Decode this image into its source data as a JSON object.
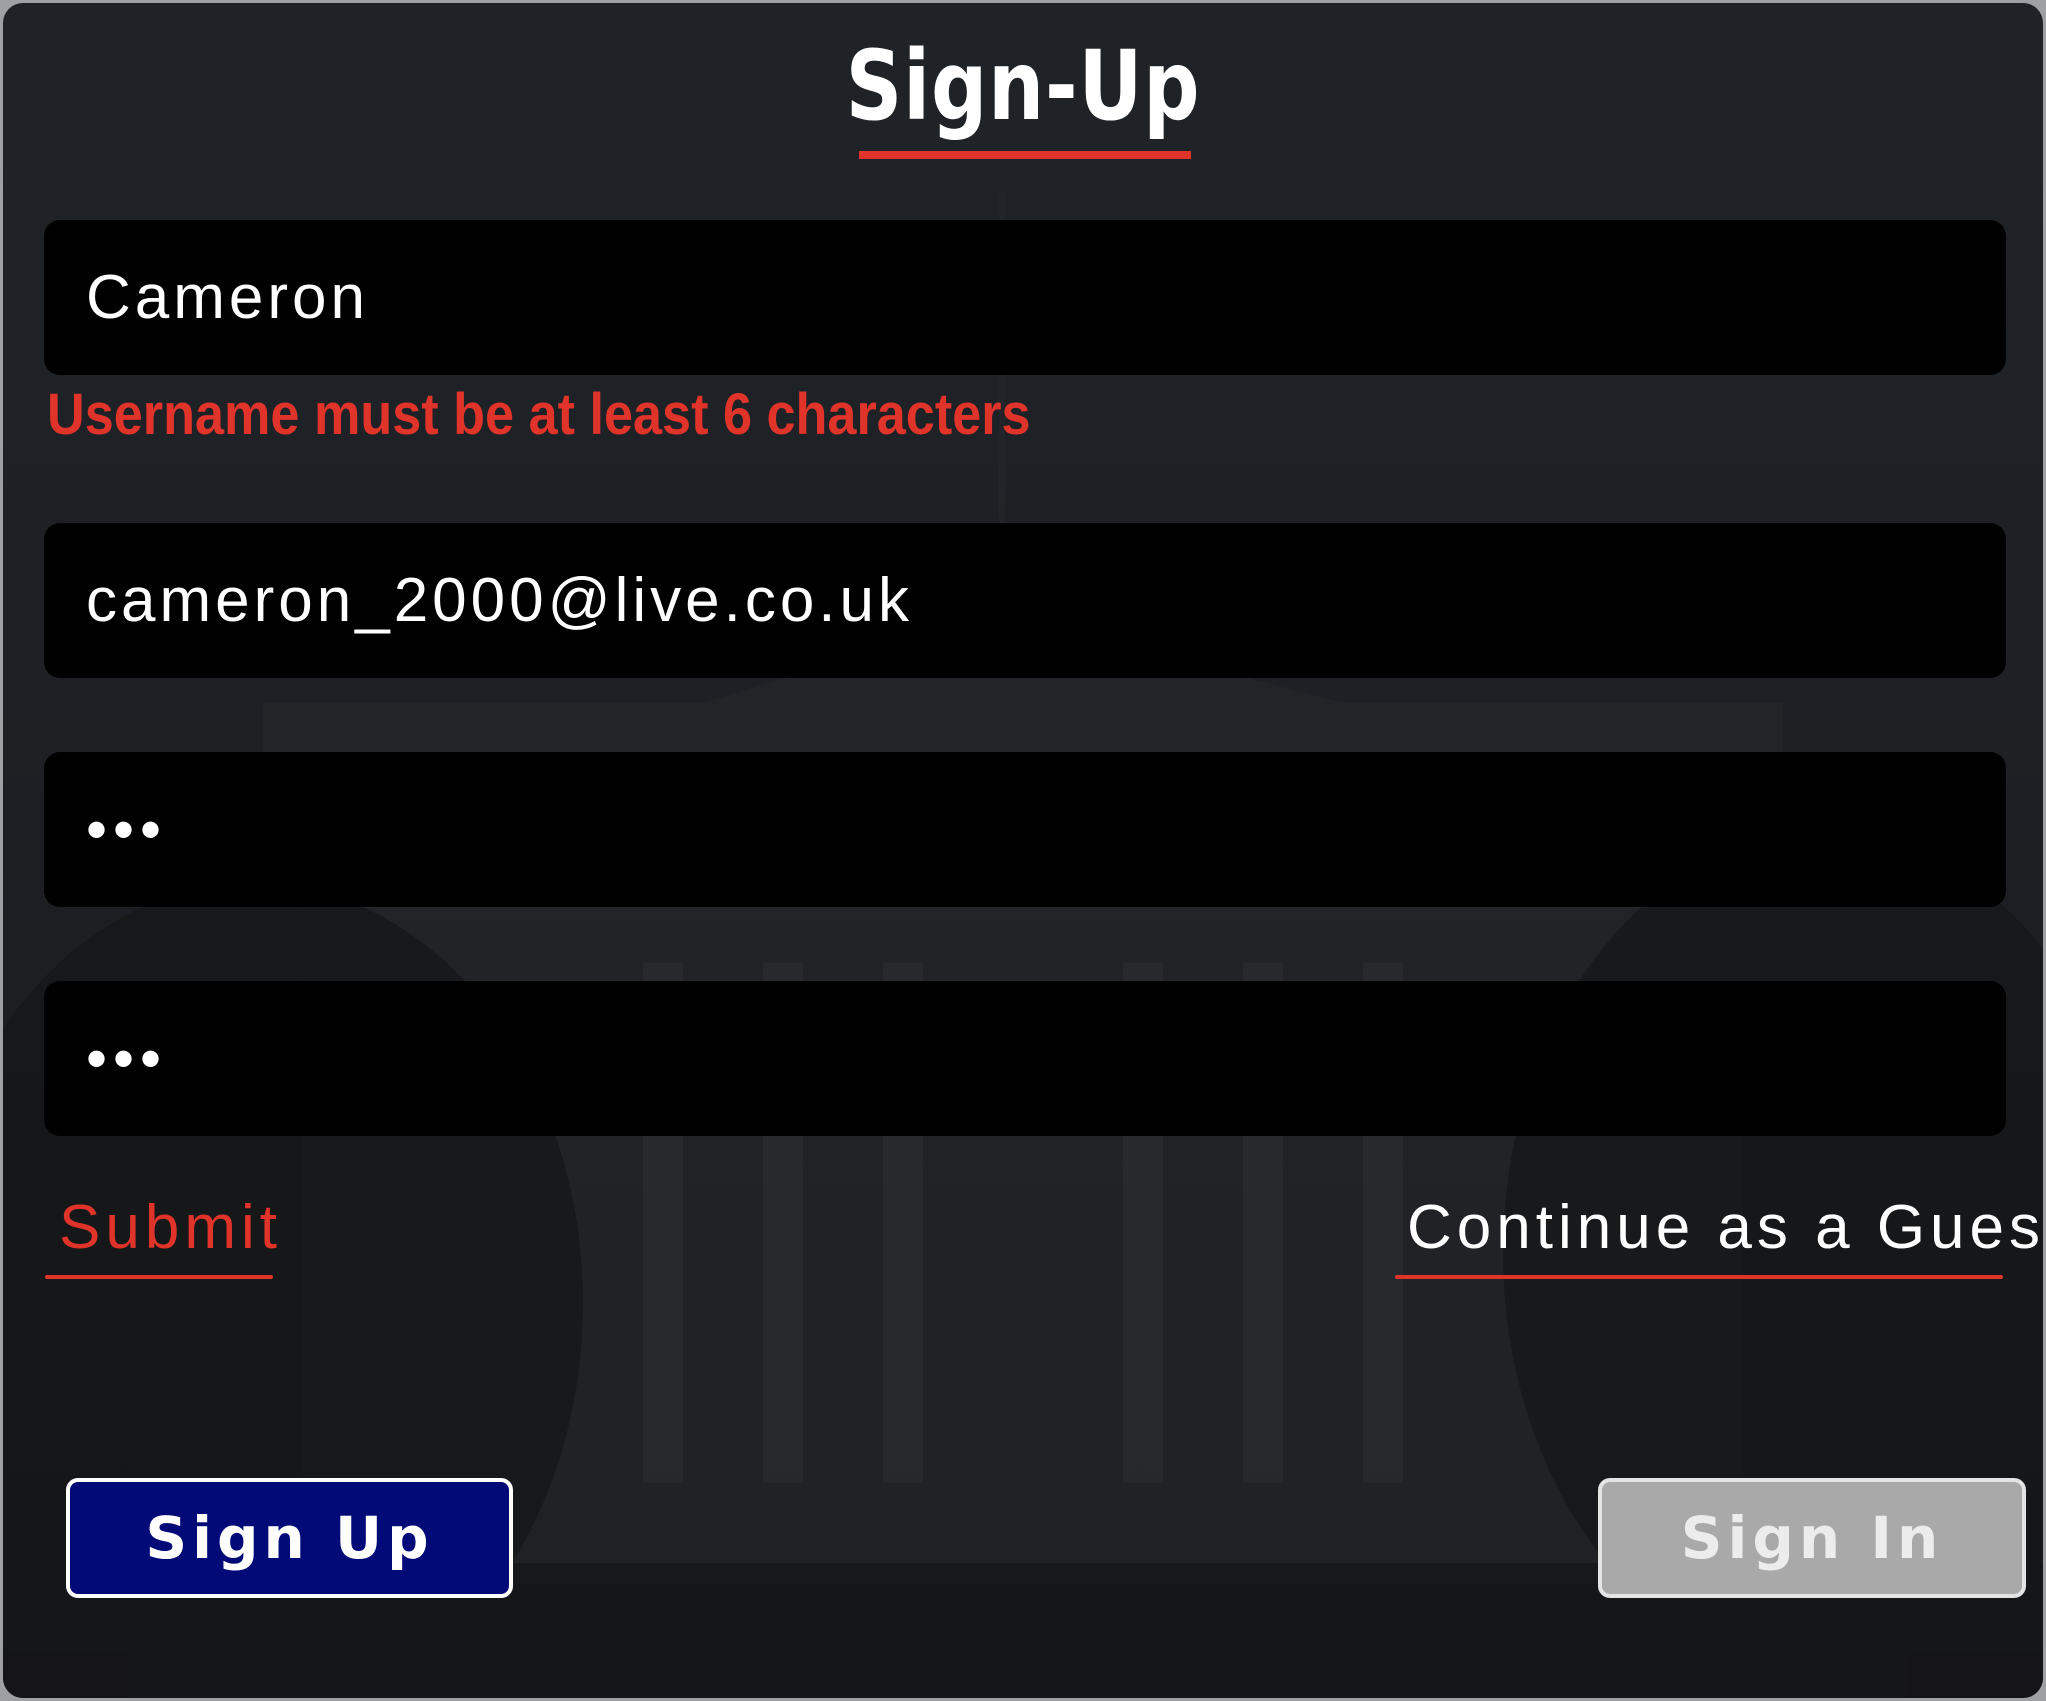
{
  "form": {
    "title": "Sign-Up",
    "username_value": "Cameron",
    "username_error": "Username must be at least 6 characters",
    "email_value": "cameron_2000@live.co.uk",
    "password_mask": "•••",
    "confirm_password_mask": "•••"
  },
  "actions": {
    "submit_label": "Submit",
    "guest_label": "Continue as a Guest",
    "signup_label": "Sign Up",
    "signin_label": "Sign In"
  },
  "colors": {
    "accent_red": "#e0342a",
    "signup_button": "#020a78",
    "signin_button": "#a9a9a9",
    "field_background": "#000000",
    "panel_background": "#1f2227"
  }
}
